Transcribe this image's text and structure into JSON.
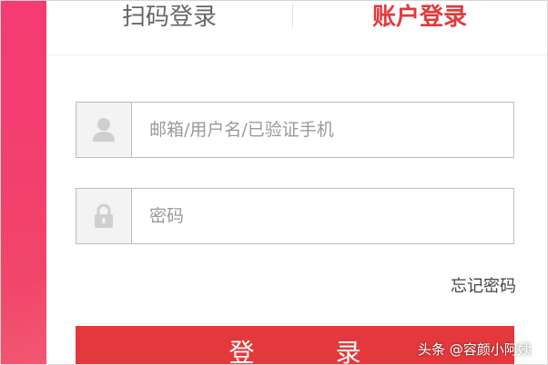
{
  "tabs": {
    "qr_login": "扫码登录",
    "account_login": "账户登录",
    "active": "account_login"
  },
  "form": {
    "username": {
      "icon": "user-icon",
      "placeholder": "邮箱/用户名/已验证手机",
      "value": ""
    },
    "password": {
      "icon": "lock-icon",
      "placeholder": "密码",
      "value": ""
    },
    "forgot_password": "忘记密码",
    "submit_label": "登 录"
  },
  "watermark": "头条 @容颜小阿姨",
  "colors": {
    "accent": "#e4393c",
    "side_background": "#f3416d",
    "field_border": "#bdbdbd",
    "icon_background": "#f3f3f3"
  }
}
